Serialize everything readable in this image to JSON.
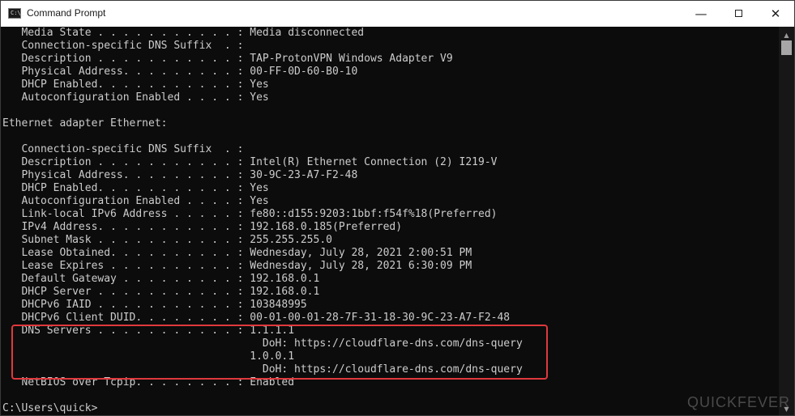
{
  "window": {
    "title": "Command Prompt",
    "icon_label": "C:\\_"
  },
  "controls": {
    "minimize": "—",
    "close": "✕"
  },
  "console": {
    "lines": [
      "   Media State . . . . . . . . . . . : Media disconnected",
      "   Connection-specific DNS Suffix  . :",
      "   Description . . . . . . . . . . . : TAP-ProtonVPN Windows Adapter V9",
      "   Physical Address. . . . . . . . . : 00-FF-0D-60-B0-10",
      "   DHCP Enabled. . . . . . . . . . . : Yes",
      "   Autoconfiguration Enabled . . . . : Yes",
      "",
      "Ethernet adapter Ethernet:",
      "",
      "   Connection-specific DNS Suffix  . :",
      "   Description . . . . . . . . . . . : Intel(R) Ethernet Connection (2) I219-V",
      "   Physical Address. . . . . . . . . : 30-9C-23-A7-F2-48",
      "   DHCP Enabled. . . . . . . . . . . : Yes",
      "   Autoconfiguration Enabled . . . . : Yes",
      "   Link-local IPv6 Address . . . . . : fe80::d155:9203:1bbf:f54f%18(Preferred)",
      "   IPv4 Address. . . . . . . . . . . : 192.168.0.185(Preferred)",
      "   Subnet Mask . . . . . . . . . . . : 255.255.255.0",
      "   Lease Obtained. . . . . . . . . . : Wednesday, July 28, 2021 2:00:51 PM",
      "   Lease Expires . . . . . . . . . . : Wednesday, July 28, 2021 6:30:09 PM",
      "   Default Gateway . . . . . . . . . : 192.168.0.1",
      "   DHCP Server . . . . . . . . . . . : 192.168.0.1",
      "   DHCPv6 IAID . . . . . . . . . . . : 103848995",
      "   DHCPv6 Client DUID. . . . . . . . : 00-01-00-01-28-7F-31-18-30-9C-23-A7-F2-48",
      "   DNS Servers . . . . . . . . . . . : 1.1.1.1",
      "                                         DoH: https://cloudflare-dns.com/dns-query",
      "                                       1.0.0.1",
      "                                         DoH: https://cloudflare-dns.com/dns-query",
      "   NetBIOS over Tcpip. . . . . . . . : Enabled",
      "",
      "C:\\Users\\quick>"
    ]
  },
  "watermark": "QUICKFEVER",
  "colors": {
    "console_bg": "#0c0c0c",
    "console_text": "#cccccc",
    "highlight": "#e0383e"
  }
}
